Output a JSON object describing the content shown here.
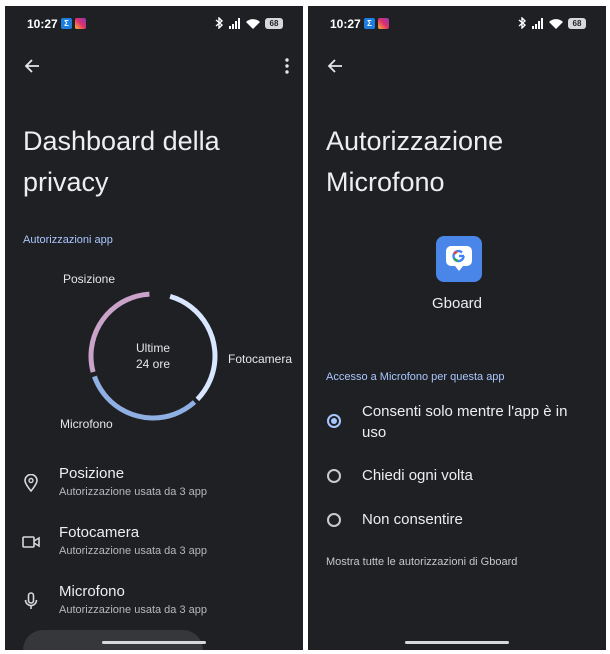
{
  "status_bar": {
    "time": "10:27",
    "battery": "68",
    "notification_icons": [
      "sigma-app-icon",
      "instagram-icon"
    ],
    "system_icons": [
      "bluetooth-icon",
      "signal-icon",
      "wifi-icon",
      "battery-icon"
    ]
  },
  "left_screen": {
    "title": "Dashboard della privacy",
    "section_header": "Autorizzazioni app",
    "donut": {
      "center_line1": "Ultime",
      "center_line2": "24 ore",
      "label_posizione": "Posizione",
      "label_fotocamera": "Fotocamera",
      "label_microfono": "Microfono",
      "colors": {
        "posizione": "#c9a3c9",
        "fotocamera": "#d8e6ff",
        "microfono": "#8fb0e3"
      }
    },
    "permissions": [
      {
        "title": "Posizione",
        "subtitle": "Autorizzazione usata da 3 app",
        "icon": "location-pin-icon"
      },
      {
        "title": "Fotocamera",
        "subtitle": "Autorizzazione usata da 3 app",
        "icon": "camera-icon"
      },
      {
        "title": "Microfono",
        "subtitle": "Autorizzazione usata da 3 app",
        "icon": "microphone-icon"
      }
    ]
  },
  "right_screen": {
    "title_line1": "Autorizzazione",
    "title_line2": "Microfono",
    "app_name": "Gboard",
    "app_icon": "gboard-icon",
    "section_header": "Accesso a Microfono per questa app",
    "options": [
      {
        "label": "Consenti solo mentre l'app è in uso",
        "selected": true
      },
      {
        "label": "Chiedi ogni volta",
        "selected": false
      },
      {
        "label": "Non consentire",
        "selected": false
      }
    ],
    "footer_link": "Mostra tutte le autorizzazioni di Gboard"
  },
  "colors": {
    "background": "#1f2023",
    "accent": "#a9c7ff",
    "text": "#eceef2"
  }
}
